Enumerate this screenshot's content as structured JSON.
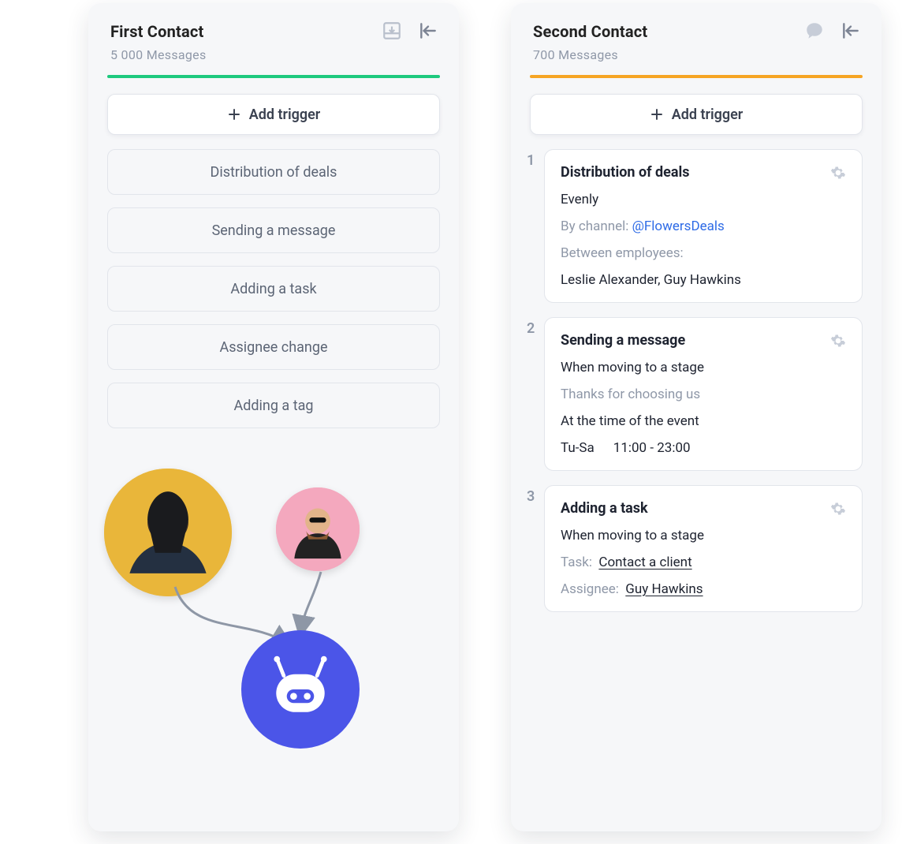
{
  "left": {
    "title": "First Contact",
    "subtitle": "5 000 Messages",
    "bar_color": "green",
    "add_trigger_label": "Add trigger",
    "options": [
      "Distribution of deals",
      "Sending a message",
      "Adding a task",
      "Assignee change",
      "Adding a tag"
    ]
  },
  "right": {
    "title": "Second Contact",
    "subtitle": "700 Messages",
    "bar_color": "orange",
    "add_trigger_label": "Add trigger",
    "steps": [
      {
        "num": "1",
        "title": "Distribution of deals",
        "evenly": "Evenly",
        "by_channel_label": "By channel: ",
        "by_channel_value": "@FlowersDeals",
        "between_label": "Between employees:",
        "employees": "Leslie Alexander, Guy Hawkins"
      },
      {
        "num": "2",
        "title": "Sending a message",
        "when": "When moving to a stage",
        "template": "Thanks for choosing us",
        "at_time": "At the time of the event",
        "days": "Tu-Sa",
        "hours": "11:00 - 23:00"
      },
      {
        "num": "3",
        "title": "Adding a task",
        "when": "When moving to a stage",
        "task_label": "Task:",
        "task_value": "Contact a client",
        "assignee_label": "Assignee:",
        "assignee_value": "Guy Hawkins"
      }
    ]
  }
}
